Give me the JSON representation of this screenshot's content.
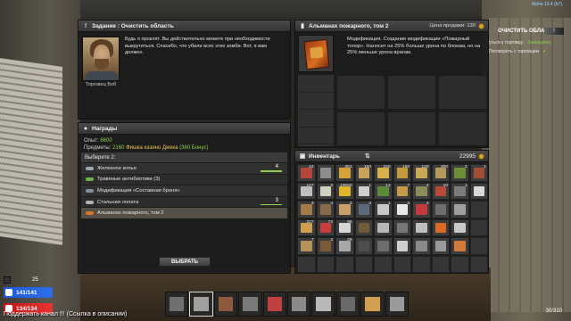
{
  "window": {
    "build": "Alpha 19.4 (b7)"
  },
  "quest": {
    "title": "Задание : Очистить область",
    "trader_name": "Торговец Боб",
    "text": "Будь я проклят. Вы действительно можете при необходимости выкрутиться. Спасибо, что убили всех этих зомби. Вот, я вам должен."
  },
  "rewards": {
    "title": "Награды",
    "xp_label": "Опыт:",
    "xp_value": "6600",
    "items_label": "Предметы:",
    "items_count": "2160",
    "items_name": "Фишка казино Джека",
    "items_bonus": "(360 Бонус)",
    "choose_label": "Выберите 2:",
    "options": [
      {
        "label": "Железное копье",
        "qty": "4",
        "icon": "spear-icon",
        "icon_color": "#9aa6b2"
      },
      {
        "label": "Травяные антибиотики (3)",
        "qty": "",
        "icon": "pill-icon",
        "icon_color": "#6fb24a"
      },
      {
        "label": "Модификация «Составная броня»",
        "qty": "",
        "icon": "armor-mod-icon",
        "icon_color": "#7f8f9c"
      },
      {
        "label": "Стальная лопата",
        "qty": "3",
        "icon": "shovel-icon",
        "icon_color": "#b0b0b0"
      },
      {
        "label": "Альманах пожарного, том 2",
        "qty": "",
        "icon": "book-icon",
        "icon_color": "#d9762a"
      }
    ],
    "choose_button": "ВЫБРАТЬ"
  },
  "item": {
    "title": "Альманах пожарного, том 2",
    "price": "Цена продажи: 130",
    "description": "Модификация. Создание модификации «Пожарный топор». Наносит на 25% больше урона по блокам, но на 25% меньше урона врагам."
  },
  "inventory": {
    "title": "Инвентарь",
    "coins": "22995",
    "slots": [
      {
        "c": "#b5463a",
        "q": "42"
      },
      {
        "c": "#8d8d8d",
        "q": ""
      },
      {
        "c": "#d8a23a",
        "q": "281"
      },
      {
        "c": "#c9a35a",
        "q": "150"
      },
      {
        "c": "#d6b04b",
        "q": "150"
      },
      {
        "c": "#c49a3a",
        "q": "150"
      },
      {
        "c": "#c9a856",
        "q": "120"
      },
      {
        "c": "#b39a5c",
        "q": "300"
      },
      {
        "c": "#6d8f3a",
        "q": "2"
      },
      {
        "c": "#a34d35",
        "q": "1"
      },
      {
        "c": "#bfbfbf",
        "q": "127"
      },
      {
        "c": "#d1d1c0",
        "q": "3"
      },
      {
        "c": "#e0b728",
        "q": "19000"
      },
      {
        "c": "#cfcfcf",
        "q": "1"
      },
      {
        "c": "#5a8a3a",
        "q": "13"
      },
      {
        "c": "#c79a4a",
        "q": "7"
      },
      {
        "c": "#8c8c5a",
        "q": "3"
      },
      {
        "c": "#b64a3a",
        "q": "10"
      },
      {
        "c": "#7a7a7a",
        "q": "1"
      },
      {
        "c": "#d9d9d9",
        "q": ""
      },
      {
        "c": "#a47a4a",
        "q": "3"
      },
      {
        "c": "#8a6a4a",
        "q": "4"
      },
      {
        "c": "#caa06a",
        "q": "2"
      },
      {
        "c": "#5b6b7b",
        "q": "2"
      },
      {
        "c": "#c8c8c8",
        "q": "1"
      },
      {
        "c": "#e9e9e9",
        "q": "3"
      },
      {
        "c": "#c23a3a",
        "q": "2"
      },
      {
        "c": "#6e6e6e",
        "q": ""
      },
      {
        "c": "#9e9e9e",
        "q": ""
      },
      {
        "c": "#3d3d3d",
        "q": ""
      },
      {
        "c": "#d0a050",
        "q": "227"
      },
      {
        "c": "#c83c3c",
        "q": "72"
      },
      {
        "c": "#d7d7d7",
        "q": "96"
      },
      {
        "c": "#6f5a3a",
        "q": ""
      },
      {
        "c": "#b8b8b8",
        "q": ""
      },
      {
        "c": "#777777",
        "q": ""
      },
      {
        "c": "#bfbfbf",
        "q": ""
      },
      {
        "c": "#d86a2a",
        "q": ""
      },
      {
        "c": "#c8c8c8",
        "q": ""
      },
      {
        "c": "#3d3d3d",
        "q": ""
      },
      {
        "c": "#b59258",
        "q": "7"
      },
      {
        "c": "#7d5a3a",
        "q": "3"
      },
      {
        "c": "#a8a8a8",
        "q": "29"
      },
      {
        "c": "#4d4d4d",
        "q": ""
      },
      {
        "c": "#6d6d6d",
        "q": ""
      },
      {
        "c": "#cfcfcf",
        "q": ""
      },
      {
        "c": "#8a8a8a",
        "q": ""
      },
      {
        "c": "#9a9a9a",
        "q": ""
      },
      {
        "c": "#d27a3a",
        "q": ""
      },
      {
        "c": "#3d3d3d",
        "q": ""
      },
      {
        "c": "#3d3d3d",
        "q": ""
      },
      {
        "c": "#3d3d3d",
        "q": ""
      },
      {
        "c": "#3d3d3d",
        "q": ""
      },
      {
        "c": "#3d3d3d",
        "q": ""
      },
      {
        "c": "#3d3d3d",
        "q": ""
      },
      {
        "c": "#3d3d3d",
        "q": ""
      },
      {
        "c": "#3d3d3d",
        "q": ""
      },
      {
        "c": "#3d3d3d",
        "q": ""
      },
      {
        "c": "#3d3d3d",
        "q": ""
      },
      {
        "c": "#3d3d3d",
        "q": ""
      }
    ]
  },
  "hud": {
    "title": "ОЧИСТИТЬ ОБЛАСТЬ",
    "line1_label": "уться к торговцу:",
    "line1_status": "Завершено",
    "line2_label": "Поговорить с торговцем",
    "level": "25",
    "health": "141/141",
    "stamina": "134/134",
    "stream_msg": "Поддержать канал !!! (Ссылка в описании)",
    "bag_count": "30/310"
  },
  "toolbelt": [
    {
      "c": "#707070"
    },
    {
      "c": "#a0a0a0"
    },
    {
      "c": "#8b5a3a"
    },
    {
      "c": "#7a7a7a"
    },
    {
      "c": "#c04040"
    },
    {
      "c": "#8a8a8a"
    },
    {
      "c": "#b8b8b8"
    },
    {
      "c": "#6a6a6a"
    },
    {
      "c": "#d0a050"
    },
    {
      "c": "#9a9a9a"
    }
  ],
  "colors": {
    "accent_green": "#8bd04a",
    "accent_yellow": "#e8c34b",
    "health_blue": "#2e6de9",
    "stamina_red": "#e83333"
  }
}
